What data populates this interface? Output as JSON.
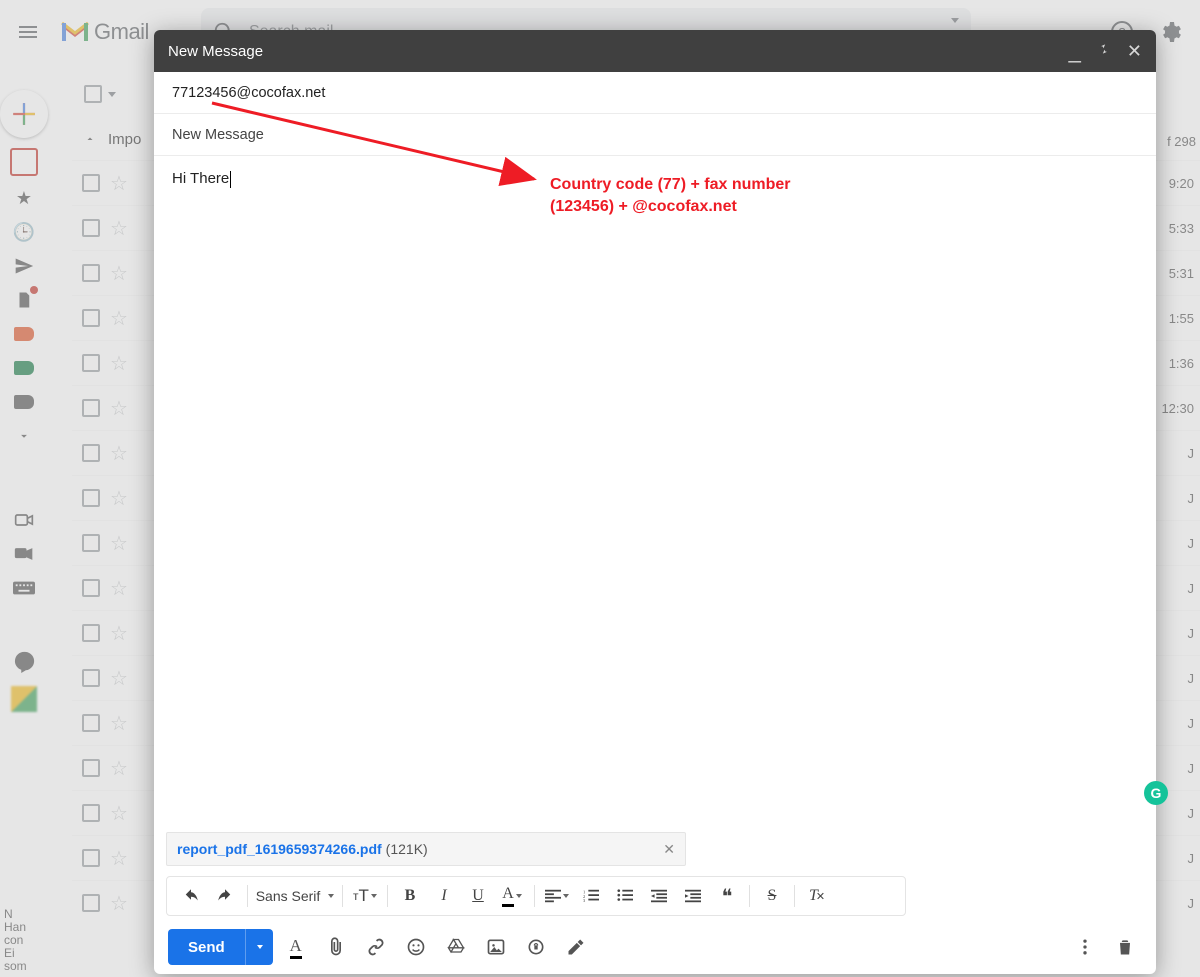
{
  "header": {
    "app_name": "Gmail",
    "search_placeholder": "Search mail"
  },
  "inbox": {
    "section_label": "Impo",
    "count_label": "f 298",
    "row_times": [
      "9:20",
      "5:33",
      "5:31",
      "1:55",
      "1:36",
      "12:30",
      "J",
      "J",
      "J",
      "J",
      "J",
      "J",
      "J",
      "J",
      "J",
      "J",
      "J"
    ],
    "cutoff_lines": [
      "N",
      "Han",
      "con",
      "Ei",
      "som"
    ]
  },
  "compose": {
    "title": "New Message",
    "to_value": "77123456@cocofax.net",
    "subject_value": "New Message",
    "body_text": "Hi There",
    "font_name": "Sans Serif",
    "send_label": "Send",
    "attachment": {
      "name": "report_pdf_1619659374266.pdf",
      "size_label": "(121K)"
    }
  },
  "annotation": {
    "line1": "Country code (77) + fax number",
    "line2": "(123456) + @cocofax.net"
  },
  "grammarly_letter": "G"
}
